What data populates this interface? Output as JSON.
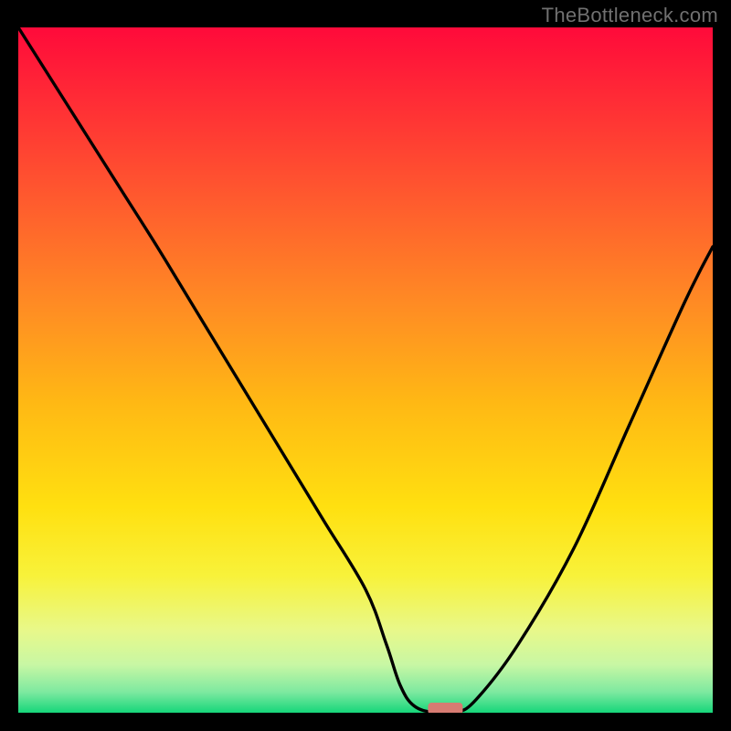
{
  "watermark": "TheBottleneck.com",
  "chart_data": {
    "type": "line",
    "title": "",
    "xlabel": "",
    "ylabel": "",
    "xlim": [
      0,
      100
    ],
    "ylim": [
      0,
      100
    ],
    "x": [
      0,
      5,
      10,
      15,
      20,
      26,
      32,
      38,
      44,
      50,
      53,
      55,
      57,
      60,
      63,
      66,
      72,
      80,
      88,
      96,
      100
    ],
    "y": [
      100,
      92,
      84,
      76,
      68,
      58,
      48,
      38,
      28,
      18,
      10,
      4,
      1,
      0,
      0,
      2,
      10,
      24,
      42,
      60,
      68
    ],
    "marker": {
      "x": 61.5,
      "y": 0,
      "w": 5,
      "h": 1.2
    },
    "gradient_stops": [
      {
        "offset": 0.0,
        "color": "#ff0a3a"
      },
      {
        "offset": 0.1,
        "color": "#ff2a36"
      },
      {
        "offset": 0.25,
        "color": "#ff5a2e"
      },
      {
        "offset": 0.4,
        "color": "#ff8a24"
      },
      {
        "offset": 0.55,
        "color": "#ffb914"
      },
      {
        "offset": 0.7,
        "color": "#ffe010"
      },
      {
        "offset": 0.8,
        "color": "#f8f23a"
      },
      {
        "offset": 0.88,
        "color": "#e8f88a"
      },
      {
        "offset": 0.93,
        "color": "#c8f7a4"
      },
      {
        "offset": 0.97,
        "color": "#7de9a0"
      },
      {
        "offset": 1.0,
        "color": "#16d67a"
      }
    ],
    "curve_color": "#000000",
    "marker_color": "#d77b72"
  }
}
